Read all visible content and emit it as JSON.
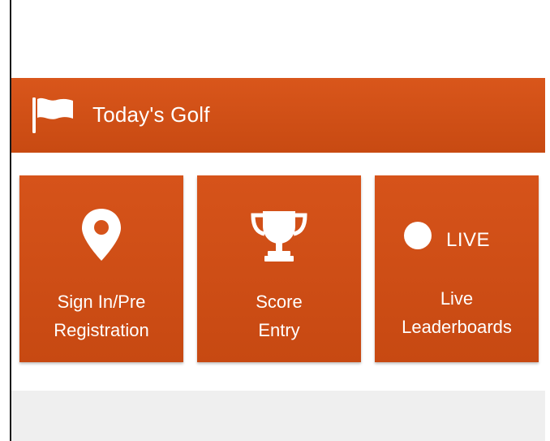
{
  "header": {
    "title": "Today's Golf",
    "icon": "flag-icon"
  },
  "tiles": [
    {
      "icon": "location-pin-icon",
      "label_line1": "Sign In/Pre",
      "label_line2": "Registration"
    },
    {
      "icon": "trophy-icon",
      "label_line1": "Score",
      "label_line2": "Entry"
    },
    {
      "icon": "live-dot-icon",
      "badge": "LIVE",
      "label_line1": "Live",
      "label_line2": "Leaderboards"
    }
  ],
  "colors": {
    "brand_orange": "#d6531a",
    "background": "#ffffff",
    "footer_gray": "#efefef"
  }
}
